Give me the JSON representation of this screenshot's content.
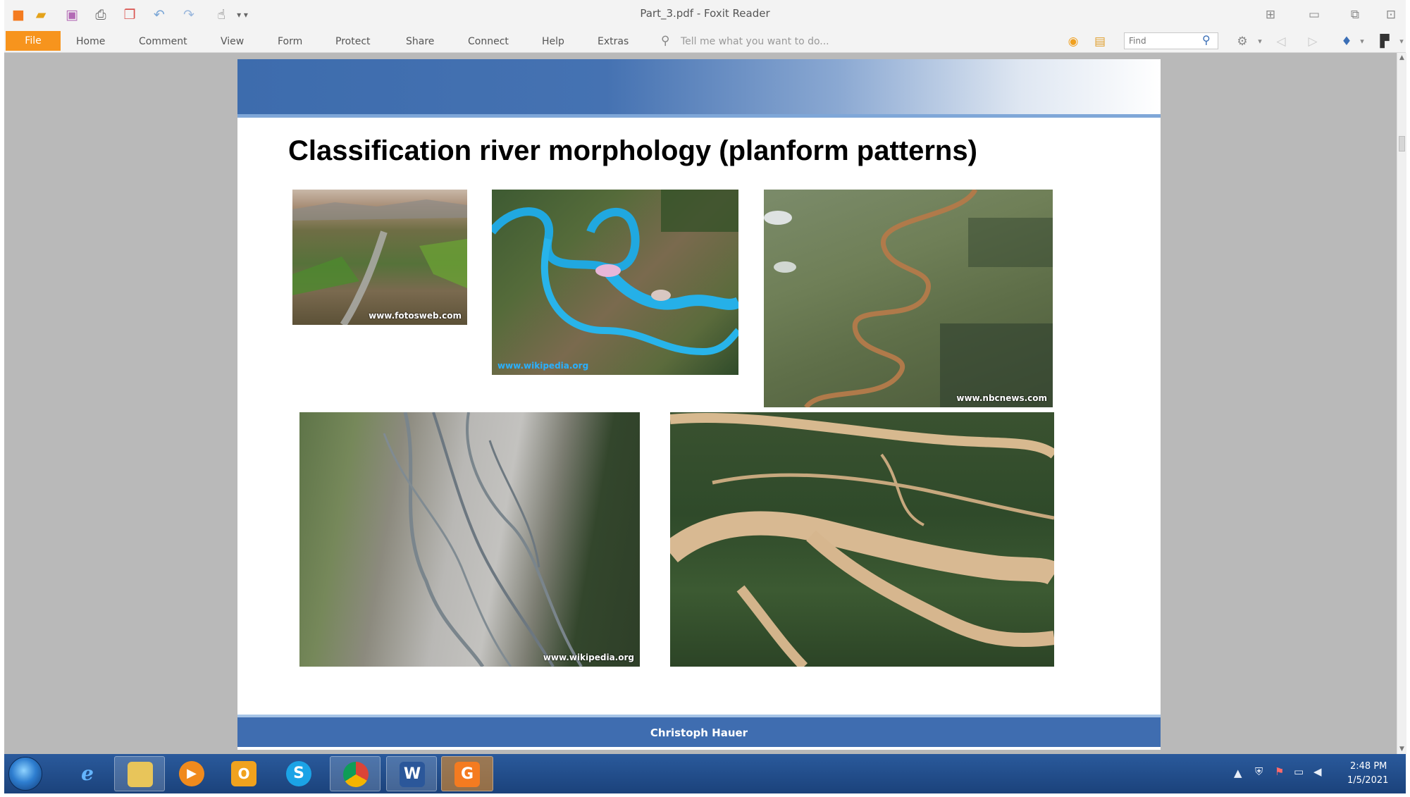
{
  "window": {
    "title": "Part_3.pdf - Foxit Reader"
  },
  "quick_access": [
    "foxit-logo-icon",
    "open-folder-icon",
    "save-icon",
    "print-icon",
    "new-doc-icon",
    "undo-icon",
    "redo-icon",
    "hand-tool-icon"
  ],
  "ribbon": {
    "file_label": "File",
    "tabs": [
      "Home",
      "Comment",
      "View",
      "Form",
      "Protect",
      "Share",
      "Connect",
      "Help",
      "Extras"
    ],
    "tell_me": "Tell me what you want to do...",
    "find_placeholder": "Find"
  },
  "slide": {
    "title": "Classification river morphology (planform patterns)",
    "footer": "Christoph Hauer",
    "photos": [
      {
        "name": "mountain-valley-photo",
        "watermark": "www.fotosweb.com"
      },
      {
        "name": "blue-river-satellite-photo",
        "watermark": "www.wikipedia.org"
      },
      {
        "name": "meandering-river-photo",
        "watermark": "www.nbcnews.com"
      },
      {
        "name": "braided-river-photo",
        "watermark": "www.wikipedia.org"
      },
      {
        "name": "anastomosing-river-satellite-photo",
        "watermark": ""
      }
    ]
  },
  "taskbar": {
    "apps": [
      "Internet Explorer",
      "Windows Explorer",
      "Media Player",
      "Outlook",
      "Skype",
      "Chrome",
      "Word",
      "Foxit Reader"
    ],
    "time": "2:48 PM",
    "date": "1/5/2021"
  }
}
